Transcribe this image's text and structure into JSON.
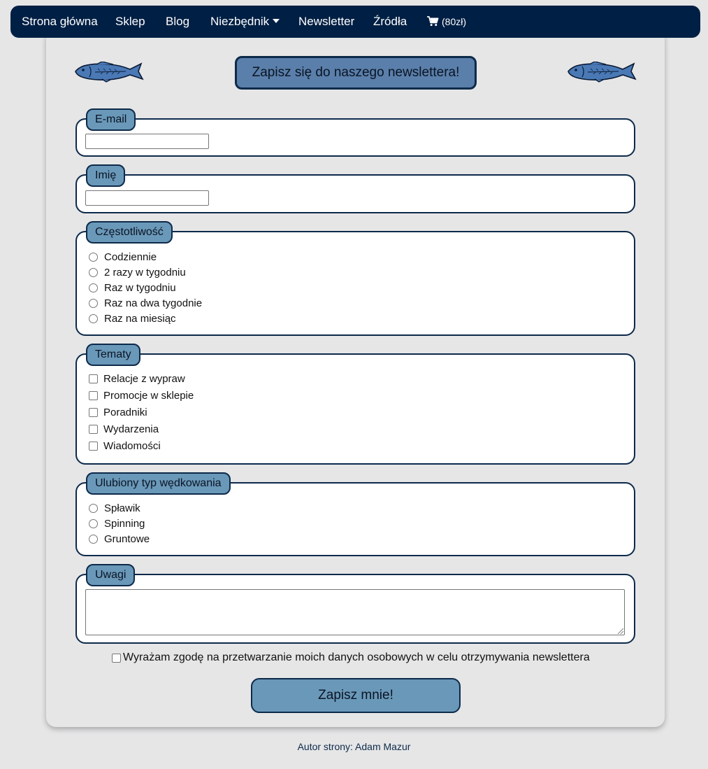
{
  "nav": {
    "items": [
      "Strona główna",
      "Sklep",
      "Blog",
      "Niezbędnik",
      "Newsletter",
      "Źródła"
    ],
    "cart_label": "(80zł)",
    "cart_icon": "shopping-cart-icon"
  },
  "form": {
    "title": "Zapisz się do naszego newslettera!",
    "email": {
      "legend": "E-mail",
      "value": ""
    },
    "name": {
      "legend": "Imię",
      "value": ""
    },
    "frequency": {
      "legend": "Częstotliwość",
      "options": [
        "Codziennie",
        "2 razy w tygodniu",
        "Raz w tygodniu",
        "Raz na dwa tygodnie",
        "Raz na miesiąc"
      ]
    },
    "topics": {
      "legend": "Tematy",
      "options": [
        "Relacje z wypraw",
        "Promocje w sklepie",
        "Poradniki",
        "Wydarzenia",
        "Wiadomości"
      ]
    },
    "fishing_type": {
      "legend": "Ulubiony typ wędkowania",
      "options": [
        "Spławik",
        "Spinning",
        "Gruntowe"
      ]
    },
    "notes": {
      "legend": "Uwagi",
      "value": ""
    },
    "consent_label": "Wyrażam zgodę na przetwarzanie moich danych osobowych w celu otrzymywania newslettera",
    "submit_label": "Zapisz mnie!"
  },
  "footer": {
    "author": "Autor strony: Adam Mazur"
  },
  "colors": {
    "nav_bg": "#001f44",
    "title_bg": "#5a7faa",
    "legend_bg": "#6a98b8",
    "border": "#0d2a4a",
    "page_bg": "#e6e6e7"
  }
}
